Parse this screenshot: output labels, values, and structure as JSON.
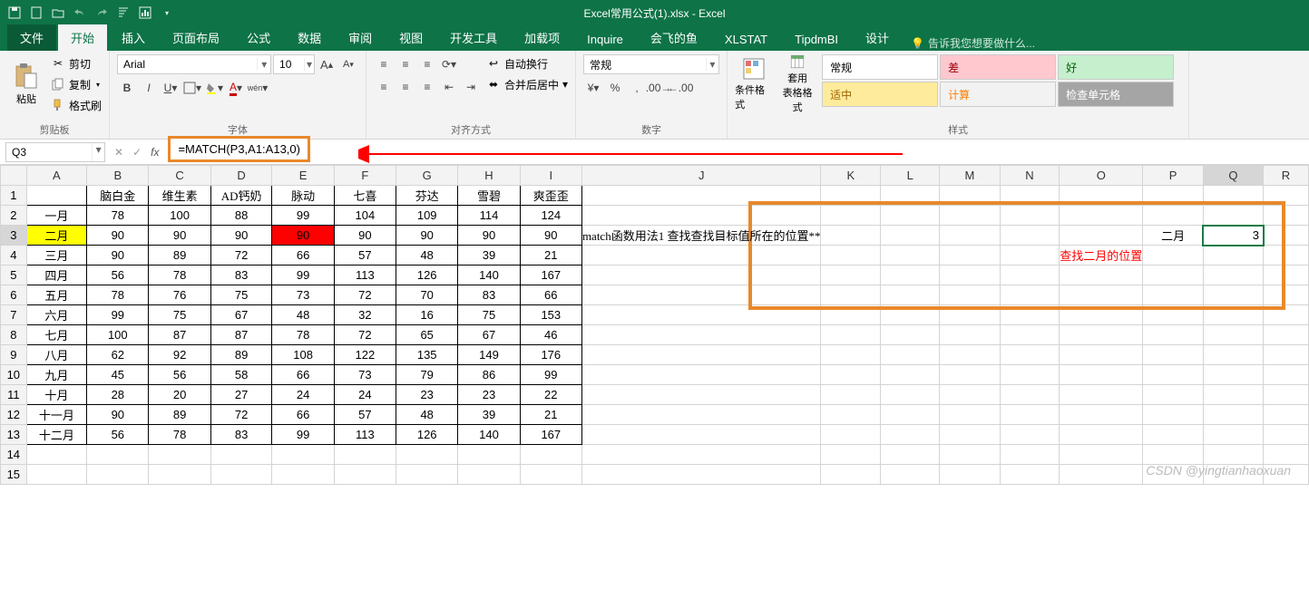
{
  "title": "Excel常用公式(1).xlsx - Excel",
  "tabs": {
    "file": "文件",
    "home": "开始",
    "insert": "插入",
    "layout": "页面布局",
    "formulas": "公式",
    "data": "数据",
    "review": "审阅",
    "view": "视图",
    "dev": "开发工具",
    "addins": "加载项",
    "inquire": "Inquire",
    "fish": "会飞的鱼",
    "xlstat": "XLSTAT",
    "tipdm": "TipdmBI",
    "design": "设计",
    "tellme": "告诉我您想要做什么..."
  },
  "ribbon": {
    "clipboard": {
      "paste": "粘贴",
      "cut": "剪切",
      "copy": "复制",
      "painter": "格式刷",
      "label": "剪贴板"
    },
    "font": {
      "name": "Arial",
      "size": "10",
      "label": "字体"
    },
    "align": {
      "wrap": "自动换行",
      "merge": "合并后居中",
      "label": "对齐方式"
    },
    "number": {
      "format": "常规",
      "label": "数字"
    },
    "styles": {
      "cond": "条件格式",
      "table": "套用\n表格格式",
      "label": "样式",
      "gallery": [
        {
          "text": "常规",
          "bg": "#ffffff",
          "color": "#000"
        },
        {
          "text": "差",
          "bg": "#ffc7ce",
          "color": "#9c0006"
        },
        {
          "text": "好",
          "bg": "#c6efce",
          "color": "#006100"
        },
        {
          "text": "适中",
          "bg": "#ffeb9c",
          "color": "#9c6500"
        },
        {
          "text": "计算",
          "bg": "#f2f2f2",
          "color": "#fa7d00"
        },
        {
          "text": "检查单元格",
          "bg": "#a5a5a5",
          "color": "#fff"
        }
      ]
    }
  },
  "formula_bar": {
    "cell_ref": "Q3",
    "formula": "=MATCH(P3,A1:A13,0)"
  },
  "columns": [
    "A",
    "B",
    "C",
    "D",
    "E",
    "F",
    "G",
    "H",
    "I",
    "J",
    "K",
    "L",
    "M",
    "N",
    "O",
    "P",
    "Q",
    "R"
  ],
  "headers_row": [
    "",
    "脑白金",
    "维生素",
    "AD钙奶",
    "脉动",
    "七喜",
    "芬达",
    "雪碧",
    "爽歪歪"
  ],
  "data_rows": [
    [
      "一月",
      78,
      100,
      88,
      99,
      104,
      109,
      114,
      124
    ],
    [
      "二月",
      90,
      90,
      90,
      90,
      90,
      90,
      90,
      90
    ],
    [
      "三月",
      90,
      89,
      72,
      66,
      57,
      48,
      39,
      21
    ],
    [
      "四月",
      56,
      78,
      83,
      99,
      113,
      126,
      140,
      167
    ],
    [
      "五月",
      78,
      76,
      75,
      73,
      72,
      70,
      83,
      66
    ],
    [
      "六月",
      99,
      75,
      67,
      48,
      32,
      16,
      75,
      153
    ],
    [
      "七月",
      100,
      87,
      87,
      78,
      72,
      65,
      67,
      46
    ],
    [
      "八月",
      62,
      92,
      89,
      108,
      122,
      135,
      149,
      176
    ],
    [
      "九月",
      45,
      56,
      58,
      66,
      73,
      79,
      86,
      99
    ],
    [
      "十月",
      28,
      20,
      27,
      24,
      24,
      23,
      23,
      22
    ],
    [
      "十一月",
      90,
      89,
      72,
      66,
      57,
      48,
      39,
      21
    ],
    [
      "十二月",
      56,
      78,
      83,
      99,
      113,
      126,
      140,
      167
    ]
  ],
  "side": {
    "desc": "match函数用法1 查找查找目标值所在的位置**",
    "p3": "二月",
    "q3": "3",
    "note": "查找二月的位置"
  },
  "watermark": "CSDN @yingtianhaoxuan"
}
